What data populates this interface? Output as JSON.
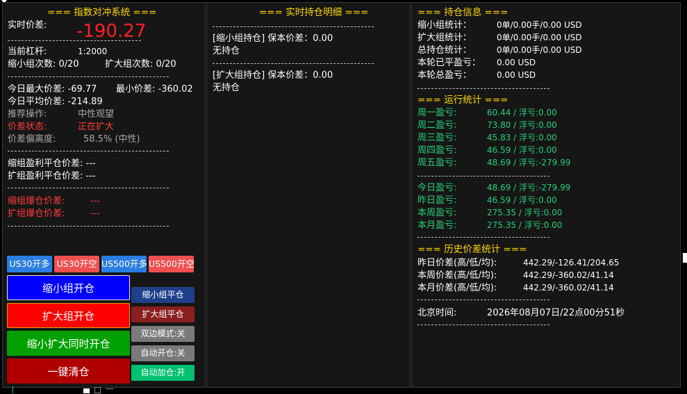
{
  "left": {
    "title": "=== 指数对冲系统 ===",
    "spread_label": "实时价差:",
    "spread_value": "-190.27",
    "leverage_label": "当前杠杆:",
    "leverage_value": "1:2000",
    "shrink_count": "缩小组次数: 0/20",
    "expand_count": "扩大组次数: 0/20",
    "today_max": "今日最大价差: -69.77",
    "min_spread": "最小价差: -360.02",
    "today_avg": "今日平均价差: -214.89",
    "recommend_label": "推荐操作:",
    "recommend_value": "中性观望",
    "status_label": "价差状态:",
    "status_value": "正在扩大",
    "deviation_label": "价差偏离度:",
    "deviation_value": "58.5% (中性)",
    "shrink_tp": "缩组盈利平仓价差: ---",
    "expand_tp": "扩组盈利平仓价差: ---",
    "shrink_liq_label": "缩组爆仓价差:",
    "shrink_liq_value": "---",
    "expand_liq_label": "扩组爆仓价差:",
    "expand_liq_value": "---",
    "buttons": {
      "us30_long": "US30开多",
      "us30_short": "US30开空",
      "us500_long": "US500开多",
      "us500_short": "US500开空",
      "shrink_open": "缩小组开仓",
      "expand_open": "扩大组开仓",
      "both_open": "缩小扩大同时开仓",
      "close_all": "一键清仓",
      "shrink_close": "缩小组平仓",
      "expand_close": "扩大组平仓",
      "dual_mode": "双边模式:关",
      "auto_open": "自动开仓:关",
      "auto_add": "自动加仓:开"
    }
  },
  "middle": {
    "title": "=== 实时持仓明细 ===",
    "shrink_header": "[缩小组持仓] 保本价差：0.00",
    "shrink_state": "无持仓",
    "expand_header": "[扩大组持仓] 保本价差：0.00",
    "expand_state": "无持仓"
  },
  "right": {
    "holdings_title": "=== 持仓信息 ===",
    "holdings": [
      {
        "label": "缩小组统计：",
        "value": "0单/0.00手/0.00 USD"
      },
      {
        "label": "扩大组统计：",
        "value": "0单/0.00手/0.00 USD"
      },
      {
        "label": "总持仓统计：",
        "value": "0单/0.00手/0.00 USD"
      },
      {
        "label": "本轮已平盈亏：",
        "value": "0.00 USD"
      },
      {
        "label": "本轮总盈亏：",
        "value": "0.00 USD"
      }
    ],
    "run_title": "=== 运行统计 ===",
    "weekdays": [
      {
        "label": "周一盈亏:",
        "value": "60.44 / 浮亏:0.00"
      },
      {
        "label": "周二盈亏:",
        "value": "73.80 / 浮亏:0.00"
      },
      {
        "label": "周三盈亏:",
        "value": "45.83 / 浮亏:0.00"
      },
      {
        "label": "周四盈亏:",
        "value": "46.59 / 浮亏:0.00"
      },
      {
        "label": "周五盈亏:",
        "value": "48.69 / 浮亏:-279.99"
      }
    ],
    "periods": [
      {
        "label": "今日盈亏:",
        "value": "48.69 / 浮亏:-279.99"
      },
      {
        "label": "昨日盈亏:",
        "value": "46.59 / 浮亏:0.00"
      },
      {
        "label": "本周盈亏:",
        "value": "275.35 / 浮亏:0.00"
      },
      {
        "label": "本月盈亏:",
        "value": "275.35 / 浮亏:0.00"
      }
    ],
    "history_title": "=== 历史价差统计 ===",
    "history": [
      {
        "label": "昨日价差(高/低/均):",
        "value": "442.29/-126.41/204.65"
      },
      {
        "label": "本周价差(高/低/均):",
        "value": "442.29/-360.02/41.14"
      },
      {
        "label": "本月价差(高/低/均):",
        "value": "442.29/-360.02/41.14"
      }
    ],
    "time_label": "北京时间:",
    "time_value": "2026年08月07日/22点00分51秒"
  },
  "colors": {
    "title": "#ffd700",
    "profit_green": "#27d07a",
    "alert_red": "#ff3b3b",
    "blue_button": "#0000ff",
    "red_button": "#ff0000",
    "green_button": "#00a000",
    "darkred_button": "#b00000"
  }
}
